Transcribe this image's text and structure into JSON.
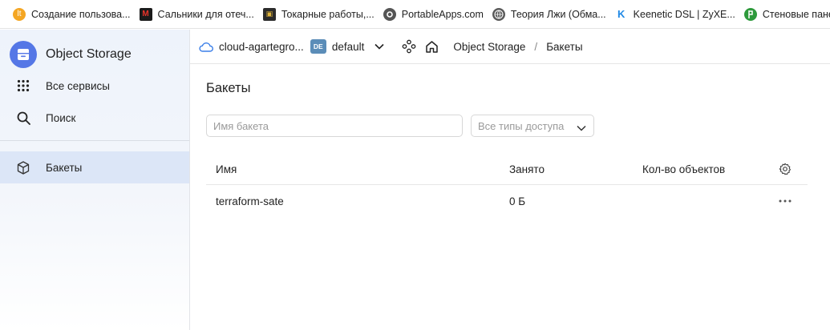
{
  "bookmarks": [
    {
      "label": "Создание пользова...",
      "icon": "lt-logo-icon",
      "color": "#f4a623"
    },
    {
      "label": "Сальники для отеч...",
      "icon": "seal-logo-icon",
      "color": "#c0171d"
    },
    {
      "label": "Токарные работы,...",
      "icon": "lathe-logo-icon",
      "color": "#2b2b2b"
    },
    {
      "label": "PortableApps.com",
      "icon": "portableapps-icon",
      "color": "#666666"
    },
    {
      "label": "Теория Лжи (Обма...",
      "icon": "globe-icon",
      "color": "#555555"
    },
    {
      "label": "Keenetic DSL | ZyXE...",
      "icon": "keenetic-icon",
      "color": "#1e88e5"
    },
    {
      "label": "Стеновые панели /...",
      "icon": "panels-logo-icon",
      "color": "#2e9a3c"
    }
  ],
  "sidebar": {
    "brand": "Object Storage",
    "items": [
      {
        "label": "Все сервисы",
        "icon": "grid-icon"
      },
      {
        "label": "Поиск",
        "icon": "search-icon"
      },
      {
        "label": "Бакеты",
        "icon": "cube-icon"
      }
    ],
    "accent": "#5577e6"
  },
  "header": {
    "cloud": "cloud-agartegro...",
    "folder_badge": "DE",
    "folder": "default",
    "breadcrumb": [
      "Object Storage",
      "Бакеты"
    ]
  },
  "main": {
    "title": "Бакеты",
    "search_placeholder": "Имя бакета",
    "access_filter": "Все типы доступа",
    "columns": [
      "Имя",
      "Занято",
      "Кол-во объектов"
    ],
    "rows": [
      {
        "name": "terraform-sate",
        "used": "0 Б",
        "objects": ""
      }
    ]
  }
}
